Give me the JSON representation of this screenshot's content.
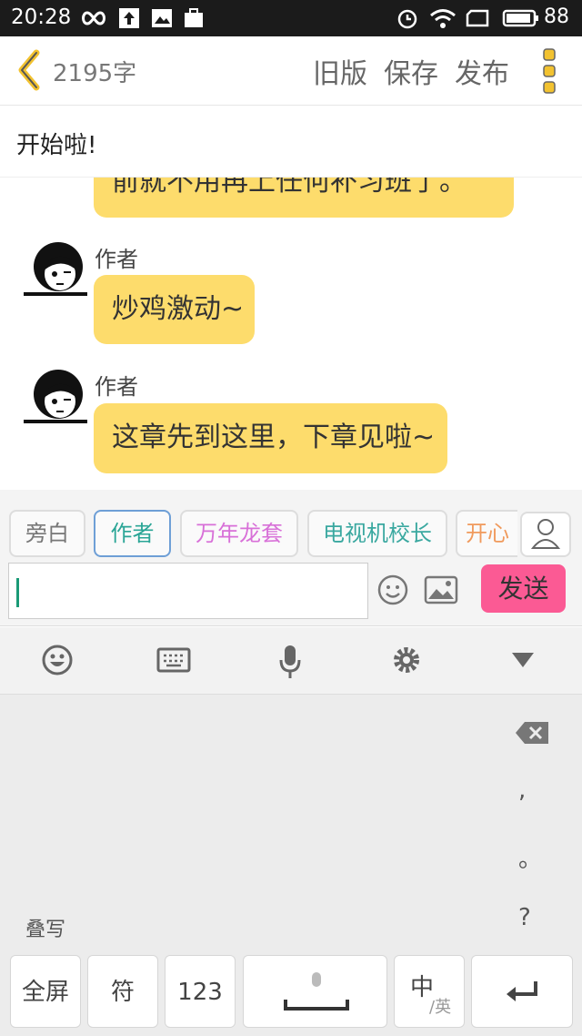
{
  "status_bar": {
    "time": "20:28",
    "battery": "88"
  },
  "header": {
    "word_count": "2195字",
    "old_version": "旧版",
    "save": "保存",
    "publish": "发布"
  },
  "chapter": {
    "title": "开始啦!"
  },
  "chat": {
    "partial_message": "前就不用再上任何补习班了。",
    "messages": [
      {
        "author": "作者",
        "text": "炒鸡激动~"
      },
      {
        "author": "作者",
        "text": "这章先到这里，下章见啦~"
      }
    ]
  },
  "roles": [
    {
      "label": "旁白",
      "color": "#777777"
    },
    {
      "label": "作者",
      "color": "#2aa596"
    },
    {
      "label": "万年龙套",
      "color": "#d870d8"
    },
    {
      "label": "电视机校长",
      "color": "#3aa8a0"
    },
    {
      "label": "开心",
      "color": "#f09a5c"
    }
  ],
  "input": {
    "value": ""
  },
  "send": {
    "label": "发送"
  },
  "colors": {
    "bubble": "#fddc6c",
    "send": "#fb5a94",
    "accent": "#f2c230"
  },
  "keyboard": {
    "toolbar": [
      "emoji-icon",
      "keyboard-icon",
      "microphone-icon",
      "gear-icon",
      "collapse-icon"
    ],
    "comma": ",",
    "period": "。",
    "question": "?",
    "overwrite": "叠写",
    "keys": {
      "fullscreen": "全屏",
      "symbols": "符",
      "numbers": "123",
      "lang_main": "中",
      "lang_sub": "/英"
    }
  }
}
